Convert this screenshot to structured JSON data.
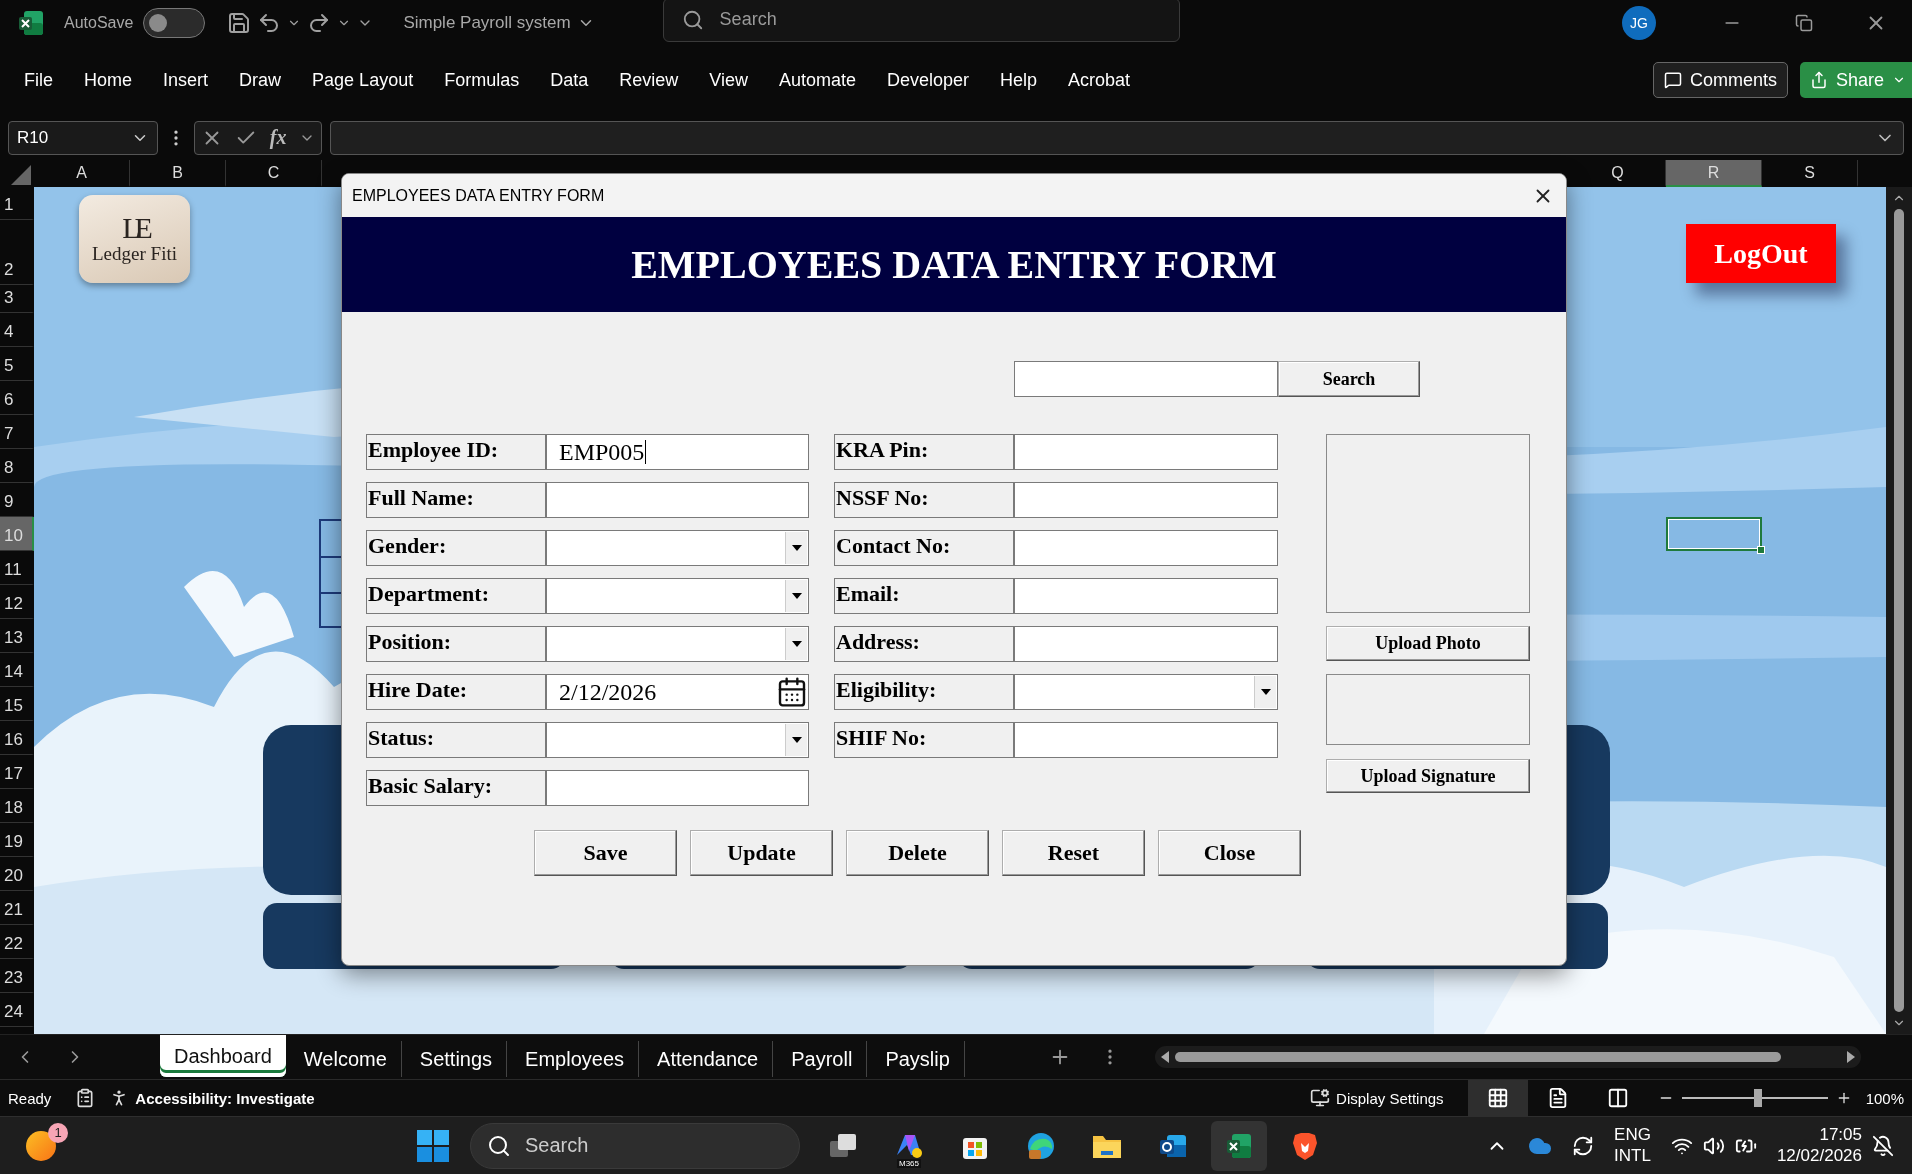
{
  "title_bar": {
    "autosave_label": "AutoSave",
    "autosave_on": false,
    "document_title": "Simple Payroll system",
    "search_placeholder": "Search",
    "avatar_initials": "JG"
  },
  "ribbon": {
    "tabs": [
      "File",
      "Home",
      "Insert",
      "Draw",
      "Page Layout",
      "Formulas",
      "Data",
      "Review",
      "View",
      "Automate",
      "Developer",
      "Help",
      "Acrobat"
    ],
    "comments_button": "Comments",
    "share_button": "Share"
  },
  "formula_bar": {
    "name_box": "R10",
    "function_label": "fx"
  },
  "columns": [
    {
      "label": "A",
      "selected": false
    },
    {
      "label": "B",
      "selected": false
    },
    {
      "label": "C",
      "selected": false
    },
    {
      "label": "Q",
      "selected": false
    },
    {
      "label": "R",
      "selected": true
    },
    {
      "label": "S",
      "selected": false
    }
  ],
  "rows": [
    {
      "label": "1",
      "selected": false
    },
    {
      "label": "2",
      "selected": false
    },
    {
      "label": "3",
      "selected": false
    },
    {
      "label": "4",
      "selected": false
    },
    {
      "label": "5",
      "selected": false
    },
    {
      "label": "6",
      "selected": false
    },
    {
      "label": "7",
      "selected": false
    },
    {
      "label": "8",
      "selected": false
    },
    {
      "label": "9",
      "selected": false
    },
    {
      "label": "10",
      "selected": true
    },
    {
      "label": "11",
      "selected": false
    },
    {
      "label": "12",
      "selected": false
    },
    {
      "label": "13",
      "selected": false
    },
    {
      "label": "14",
      "selected": false
    },
    {
      "label": "15",
      "selected": false
    },
    {
      "label": "16",
      "selected": false
    },
    {
      "label": "17",
      "selected": false
    },
    {
      "label": "18",
      "selected": false
    },
    {
      "label": "19",
      "selected": false
    },
    {
      "label": "20",
      "selected": false
    },
    {
      "label": "21",
      "selected": false
    },
    {
      "label": "22",
      "selected": false
    },
    {
      "label": "23",
      "selected": false
    },
    {
      "label": "24",
      "selected": false
    }
  ],
  "sheet": {
    "logo": {
      "monogram": "LE",
      "name": "Ledger Fiti"
    },
    "logout_button": "LogOut"
  },
  "dialog": {
    "title": "EMPLOYEES DATA ENTRY FORM",
    "heading": "EMPLOYEES DATA ENTRY FORM",
    "search_button": "Search",
    "left_fields": [
      {
        "label": "Employee ID:",
        "kind": "text",
        "value": "EMP005",
        "focused": true
      },
      {
        "label": "Full Name:",
        "kind": "text",
        "focused": false
      },
      {
        "label": "Gender:",
        "kind": "dropdown",
        "focused": false
      },
      {
        "label": "Department:",
        "kind": "dropdown",
        "focused": false
      },
      {
        "label": "Position:",
        "kind": "dropdown",
        "focused": false
      },
      {
        "label": "Hire Date:",
        "kind": "date",
        "value": "2/12/2026",
        "focused": false
      },
      {
        "label": "Status:",
        "kind": "dropdown",
        "focused": false
      },
      {
        "label": "Basic Salary:",
        "kind": "text",
        "focused": false
      }
    ],
    "right_fields": [
      {
        "label": "KRA Pin:",
        "kind": "text",
        "focused": false
      },
      {
        "label": "NSSF No:",
        "kind": "text",
        "focused": false
      },
      {
        "label": "Contact No:",
        "kind": "text",
        "focused": false
      },
      {
        "label": "Email:",
        "kind": "text",
        "focused": false
      },
      {
        "label": "Address:",
        "kind": "text",
        "focused": false
      },
      {
        "label": "Eligibility:",
        "kind": "dropdown",
        "focused": false
      },
      {
        "label": "SHIF No:",
        "kind": "text",
        "focused": false
      }
    ],
    "photo_button": "Upload Photo",
    "signature_button": "Upload Signature",
    "buttons": [
      "Save",
      "Update",
      "Delete",
      "Reset",
      "Close"
    ]
  },
  "sheet_tabs": [
    {
      "label": "Dashboard",
      "selected": true
    },
    {
      "label": "Welcome",
      "selected": false
    },
    {
      "label": "Settings",
      "selected": false
    },
    {
      "label": "Employees",
      "selected": false
    },
    {
      "label": "Attendance",
      "selected": false
    },
    {
      "label": "Payroll",
      "selected": false
    },
    {
      "label": "Payslip",
      "selected": false
    }
  ],
  "status_bar": {
    "ready": "Ready",
    "accessibility": "Accessibility: Investigate",
    "display_settings": "Display Settings",
    "views": [
      {
        "kind": "normal",
        "selected": true
      },
      {
        "kind": "page_layout",
        "selected": false
      },
      {
        "kind": "page_break",
        "selected": false
      }
    ],
    "zoom": {
      "level": 0.52,
      "reading": "100%"
    }
  },
  "taskbar": {
    "notification_badge": "1",
    "search_placeholder": "Search",
    "apps": [
      {
        "kind": "task_view",
        "active": false
      },
      {
        "kind": "copilot",
        "label": "M365",
        "active": false
      },
      {
        "kind": "store",
        "active": false
      },
      {
        "kind": "edge",
        "active": false
      },
      {
        "kind": "files",
        "active": false
      },
      {
        "kind": "outlook",
        "active": false
      },
      {
        "kind": "excel",
        "active": true
      },
      {
        "kind": "brave",
        "active": false
      }
    ],
    "language": "ENG",
    "layout": "INTL",
    "time": "17:05",
    "date": "12/02/2026"
  }
}
